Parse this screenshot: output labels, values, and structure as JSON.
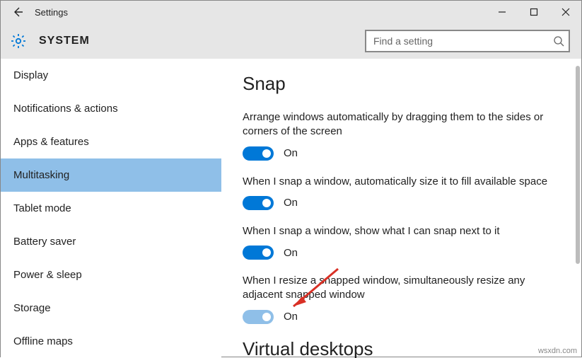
{
  "window": {
    "title": "Settings"
  },
  "header": {
    "system": "SYSTEM"
  },
  "search": {
    "placeholder": "Find a setting"
  },
  "sidebar": {
    "items": [
      {
        "label": "Display"
      },
      {
        "label": "Notifications & actions"
      },
      {
        "label": "Apps & features"
      },
      {
        "label": "Multitasking",
        "selected": true
      },
      {
        "label": "Tablet mode"
      },
      {
        "label": "Battery saver"
      },
      {
        "label": "Power & sleep"
      },
      {
        "label": "Storage"
      },
      {
        "label": "Offline maps"
      }
    ]
  },
  "main": {
    "heading": "Snap",
    "settings": [
      {
        "label": "Arrange windows automatically by dragging them to the sides or corners of the screen",
        "state": "On"
      },
      {
        "label": "When I snap a window, automatically size it to fill available space",
        "state": "On"
      },
      {
        "label": "When I snap a window, show what I can snap next to it",
        "state": "On"
      },
      {
        "label": "When I resize a snapped window, simultaneously resize any adjacent snapped window",
        "state": "On",
        "light": true
      }
    ],
    "next_heading": "Virtual desktops"
  },
  "watermark": "wsxdn.com"
}
